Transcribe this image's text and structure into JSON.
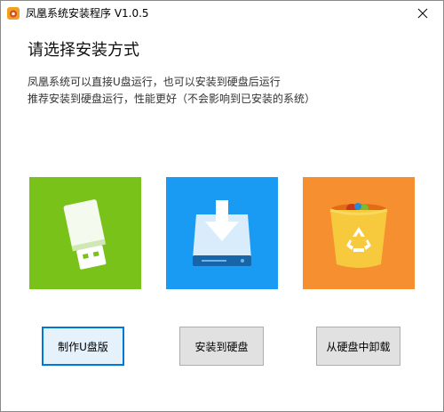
{
  "window": {
    "title": "凤凰系统安装程序 V1.0.5",
    "close_glyph": "✕"
  },
  "main": {
    "heading": "请选择安装方式",
    "desc_line1": "凤凰系统可以直接U盘运行，也可以安装到硬盘后运行",
    "desc_line2": "推荐安装到硬盘运行，性能更好（不会影响到已安装的系统）"
  },
  "options": [
    {
      "icon": "usb-drive-icon",
      "color": "#78c21a",
      "button_label": "制作U盘版"
    },
    {
      "icon": "download-to-disk-icon",
      "color": "#1a9bf3",
      "button_label": "安装到硬盘"
    },
    {
      "icon": "recycle-bin-icon",
      "color": "#f58f2f",
      "button_label": "从硬盘中卸载"
    }
  ]
}
